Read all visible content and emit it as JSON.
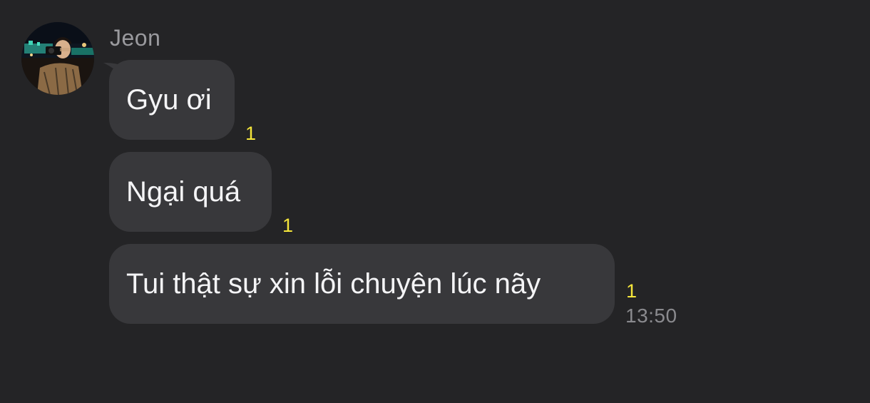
{
  "sender": {
    "name": "Jeon",
    "avatar_icon": "profile-photo"
  },
  "messages": [
    {
      "text": "Gyu ơi",
      "unread": "1"
    },
    {
      "text": "Ngại quá",
      "unread": "1"
    },
    {
      "text": "Tui thật sự xin lỗi chuyện lúc nãy",
      "unread": "1",
      "time": "13:50"
    }
  ],
  "colors": {
    "background": "#242426",
    "bubble": "#38383b",
    "unread": "#f5e63b",
    "meta_text": "#8a8a8e"
  }
}
